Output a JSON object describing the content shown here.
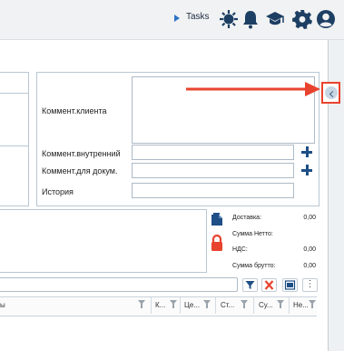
{
  "header": {
    "tasks_label": "Tasks",
    "icons": [
      "settings-sun-icon",
      "bell-icon",
      "graduation-cap-icon",
      "gear-icon",
      "user-icon"
    ]
  },
  "comments": {
    "client_label": "Коммент.клиента",
    "client_value": "",
    "internal_label": "Коммент.внутренний",
    "internal_value": "",
    "doc_label": "Коммент.для докум.",
    "doc_value": "",
    "history_label": "История",
    "history_value": ""
  },
  "summary": {
    "delivery_label": "Доставка:",
    "delivery_value": "0,00",
    "net_label": "Сумма Нетто:",
    "net_value": "",
    "vat_label": "НДС:",
    "vat_value": "0,00",
    "gross_label": "Сумма брутто:",
    "gross_value": "0,00"
  },
  "grid": {
    "columns": [
      "ы",
      "К...",
      "Це...",
      "Ст...",
      "Су...",
      "Не..."
    ],
    "more_label": "⋮"
  },
  "colors": {
    "accent_red": "#e8432e",
    "navy": "#1e4f86",
    "border": "#b8c7d3"
  }
}
